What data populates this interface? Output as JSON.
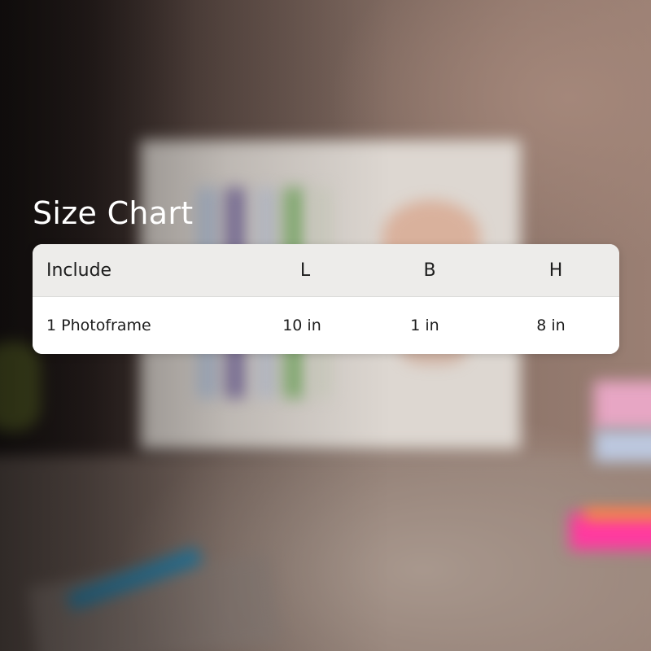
{
  "size_chart": {
    "title": "Size Chart",
    "columns": [
      "Include",
      "L",
      "B",
      "H"
    ],
    "rows": [
      [
        "1 Photoframe",
        "10 in",
        "1 in",
        "8 in"
      ]
    ]
  }
}
